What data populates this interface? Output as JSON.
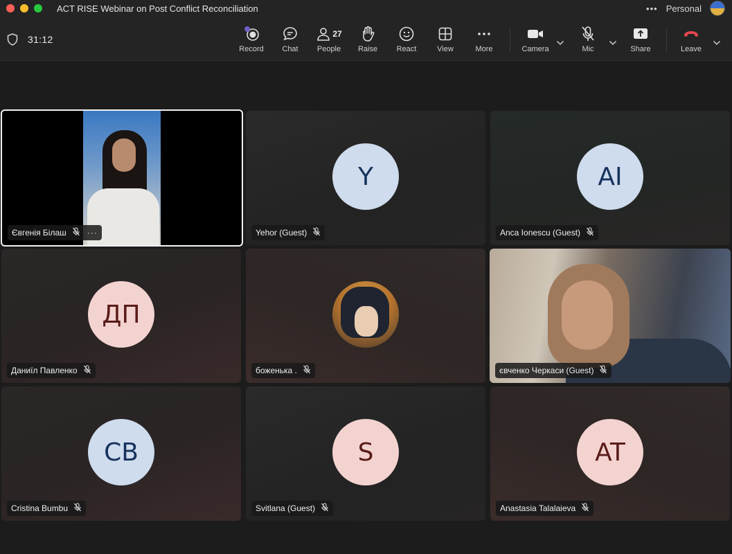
{
  "window": {
    "title": "ACT RISE Webinar on Post Conflict Reconciliation",
    "profile_label": "Personal"
  },
  "toolbar": {
    "timer": "31:12",
    "record_label": "Record",
    "chat_label": "Chat",
    "people_label": "People",
    "people_count": "27",
    "raise_label": "Raise",
    "react_label": "React",
    "view_label": "View",
    "more_label": "More",
    "camera_label": "Camera",
    "mic_label": "Mic",
    "share_label": "Share",
    "leave_label": "Leave"
  },
  "participants": [
    {
      "name": "Євгенія Білаш",
      "type": "video",
      "muted": true,
      "active": true
    },
    {
      "name": "Yehor (Guest)",
      "initials": "Y",
      "type": "avatar",
      "avatar_color": "blue",
      "muted": true
    },
    {
      "name": "Anca Ionescu (Guest)",
      "initials": "AI",
      "type": "avatar",
      "avatar_color": "blue",
      "muted": true
    },
    {
      "name": "Даниїл Павленко",
      "initials": "ДП",
      "type": "avatar",
      "avatar_color": "pink",
      "muted": true
    },
    {
      "name": "боженька .",
      "type": "picture",
      "muted": true
    },
    {
      "name": "євченко Черкаси (Guest)",
      "type": "video",
      "muted": true
    },
    {
      "name": "Cristina Bumbu",
      "initials": "CB",
      "type": "avatar",
      "avatar_color": "blue",
      "muted": true
    },
    {
      "name": "Svitlana (Guest)",
      "initials": "S",
      "type": "avatar",
      "avatar_color": "pink",
      "muted": true
    },
    {
      "name": "Anastasia Talalaieva",
      "initials": "AT",
      "type": "avatar",
      "avatar_color": "pink",
      "muted": true
    }
  ],
  "colors": {
    "background": "#1c1c1c",
    "toolbar": "#242424",
    "leave_red": "#e5484d",
    "avatar_blue_bg": "#cfdcee",
    "avatar_blue_fg": "#16325c",
    "avatar_pink_bg": "#f3d3d0",
    "avatar_pink_fg": "#5a1c19"
  }
}
